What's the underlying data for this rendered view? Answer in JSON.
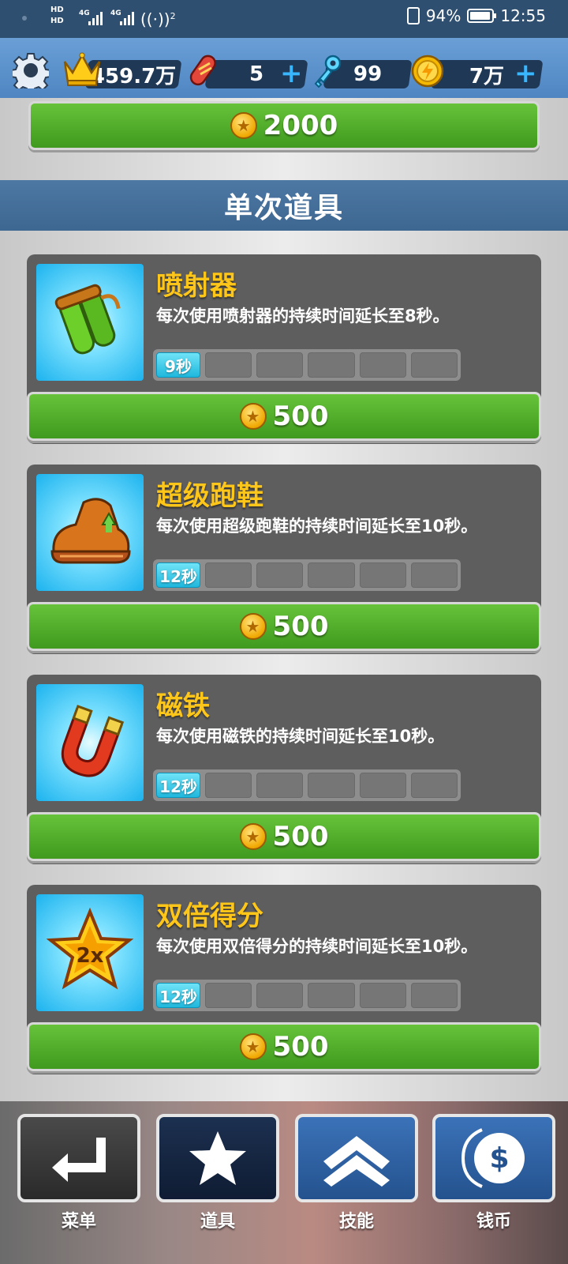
{
  "status_bar": {
    "net_label_1": "HD",
    "net_label_2": "HD",
    "gen_1": "4G",
    "gen_2": "4G",
    "wifi_sup": "2",
    "battery": "94%",
    "time": "12:55"
  },
  "resources": {
    "crowns": "459.7万",
    "boards": "5",
    "keys": "99",
    "coins": "7万",
    "plus": "+"
  },
  "top_button": {
    "price": "2000"
  },
  "section": {
    "title": "单次道具"
  },
  "powerups": [
    {
      "name": "喷射器",
      "description": "每次使用喷射器的持续时间延长至8秒。",
      "level_label": "9秒",
      "price": "500",
      "icon": "jetpack-icon"
    },
    {
      "name": "超级跑鞋",
      "description": "每次使用超级跑鞋的持续时间延长至10秒。",
      "level_label": "12秒",
      "price": "500",
      "icon": "super-sneakers-icon"
    },
    {
      "name": "磁铁",
      "description": "每次使用磁铁的持续时间延长至10秒。",
      "level_label": "12秒",
      "price": "500",
      "icon": "magnet-icon"
    },
    {
      "name": "双倍得分",
      "description": "每次使用双倍得分的持续时间延长至10秒。",
      "level_label": "12秒",
      "price": "500",
      "icon": "score-multiplier-star-icon",
      "star_text": "2x"
    }
  ],
  "nav": {
    "menu": "菜单",
    "items": "道具",
    "skills": "技能",
    "coins": "钱币",
    "dollar": "$"
  },
  "colors": {
    "accent_green": "#3f9a1e",
    "title_yellow": "#ffc61a",
    "header_blue": "#3d6790",
    "level_cyan": "#20b8dd"
  }
}
